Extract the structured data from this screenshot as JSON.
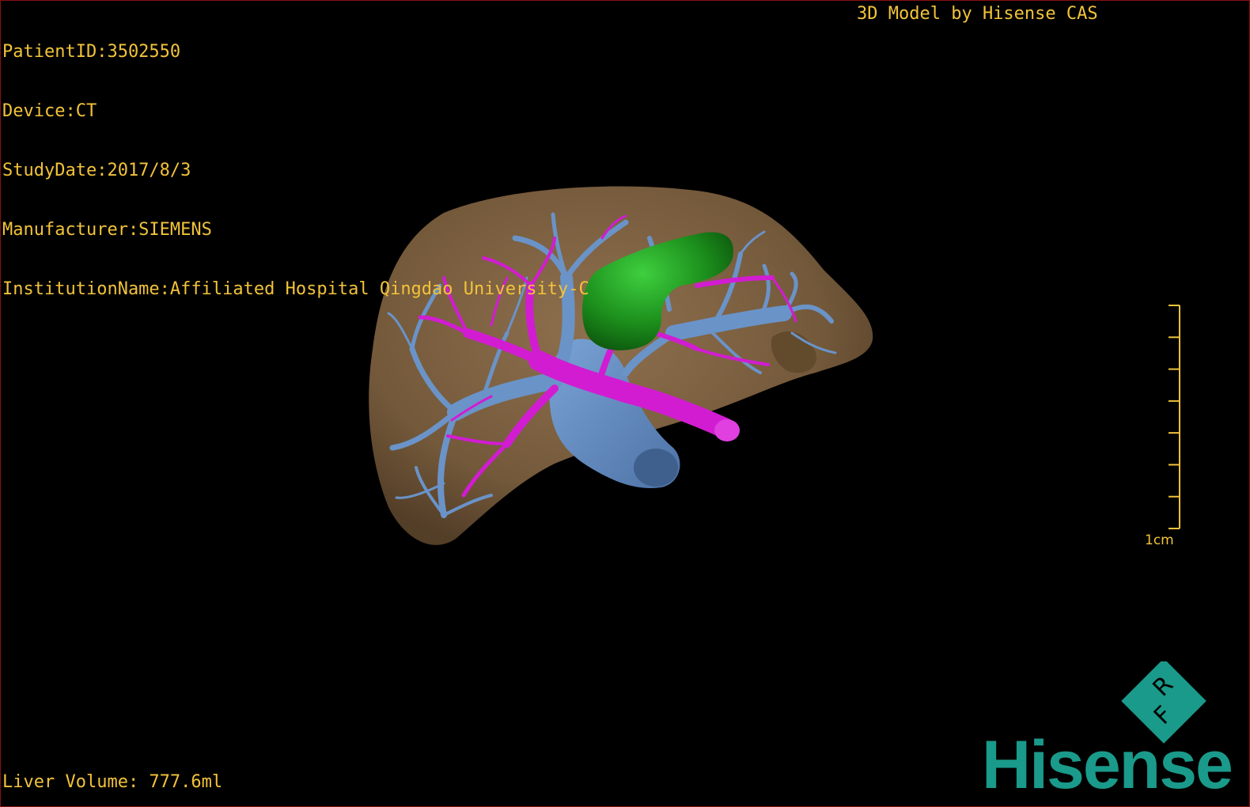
{
  "dicom_info": {
    "patient_id": "PatientID:3502550",
    "device": "Device:CT",
    "study_date": "StudyDate:2017/8/3",
    "manufacturer": "Manufacturer:SIEMENS",
    "institution": "InstitutionName:Affiliated Hospital Qingdao University-C"
  },
  "credit": "3D Model by Hisense CAS",
  "liver_volume": "Liver Volume: 777.6ml",
  "scale": {
    "label": "1cm",
    "ticks": 8
  },
  "logo": {
    "word": "Hisense",
    "badge_letters": [
      "R",
      "F"
    ]
  },
  "colors": {
    "overlay_text": "#f2c33a",
    "liver": "#8a6a48",
    "portal_vein": "#d21cd2",
    "hepatic_vein": "#6a93c8",
    "gallbladder": "#1f8a1f",
    "logo": "#1a9a8a"
  }
}
